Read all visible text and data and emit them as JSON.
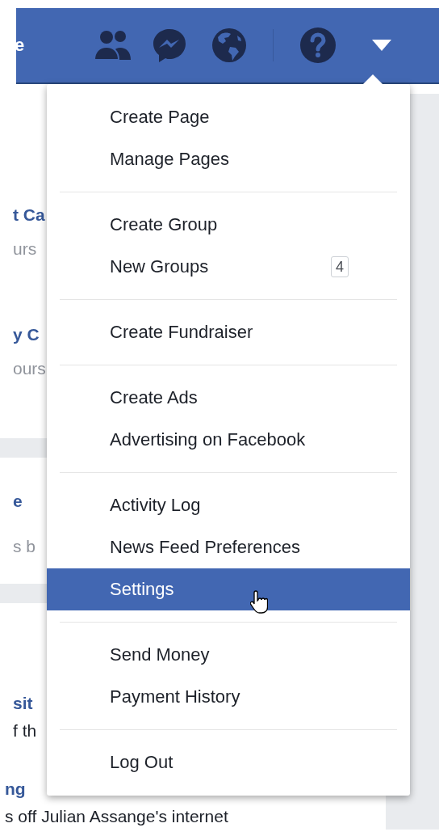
{
  "header": {
    "left_text": "e",
    "icons": [
      {
        "kind": "friends"
      },
      {
        "kind": "messenger"
      },
      {
        "kind": "globe"
      },
      {
        "kind": "divider"
      },
      {
        "kind": "help"
      },
      {
        "kind": "caret"
      }
    ]
  },
  "feed": [
    {
      "kind": "story",
      "title": "t Ca",
      "meta": "urs"
    },
    {
      "kind": "story",
      "title": "y C",
      "meta": "ours"
    },
    {
      "kind": "band"
    },
    {
      "kind": "story",
      "title": "e",
      "meta": "s b"
    },
    {
      "kind": "band"
    },
    {
      "kind": "post",
      "title": "sit",
      "meta": "f th"
    },
    {
      "kind": "post",
      "title": "ng",
      "meta": "s off Julian Assange's internet"
    }
  ],
  "menu": {
    "sections": [
      {
        "items": [
          {
            "label": "Create Page",
            "selected": false
          },
          {
            "label": "Manage Pages",
            "selected": false
          }
        ]
      },
      {
        "items": [
          {
            "label": "Create Group",
            "selected": false
          },
          {
            "label": "New Groups",
            "badge": "4",
            "selected": false
          }
        ]
      },
      {
        "items": [
          {
            "label": "Create Fundraiser",
            "selected": false
          }
        ]
      },
      {
        "items": [
          {
            "label": "Create Ads",
            "selected": false
          },
          {
            "label": "Advertising on Facebook",
            "selected": false
          }
        ]
      },
      {
        "items": [
          {
            "label": "Activity Log",
            "selected": false
          },
          {
            "label": "News Feed Preferences",
            "selected": false
          },
          {
            "label": "Settings",
            "selected": true
          }
        ]
      },
      {
        "items": [
          {
            "label": "Send Money",
            "selected": false
          },
          {
            "label": "Payment History",
            "selected": false
          }
        ]
      },
      {
        "items": [
          {
            "label": "Log Out",
            "selected": false
          }
        ]
      }
    ]
  }
}
